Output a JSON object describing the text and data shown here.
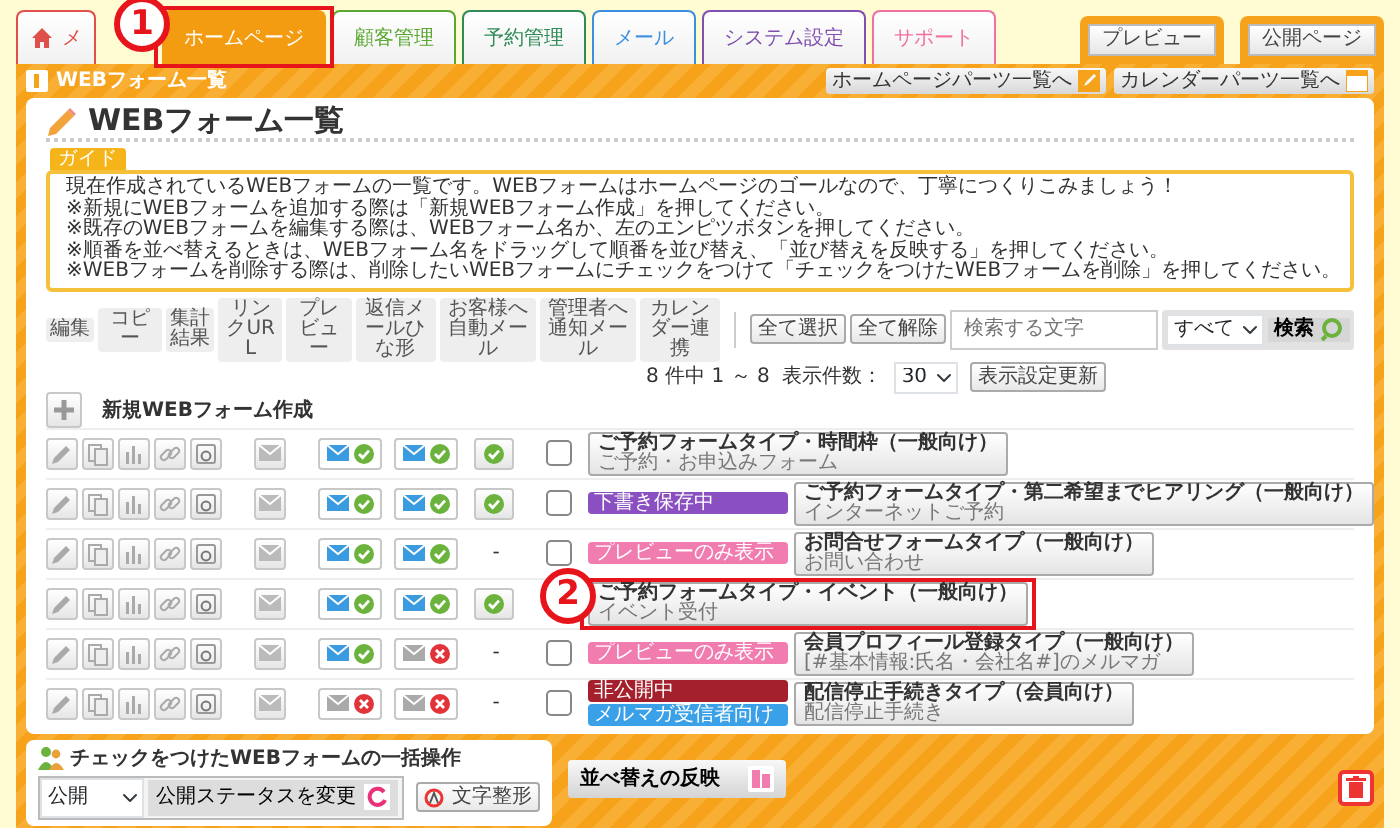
{
  "tabs": [
    {
      "kind": "home",
      "label": "メ",
      "color": "#e0504a",
      "selected": false
    },
    {
      "kind": "section",
      "label": "ホームページ",
      "color": "#f39c12",
      "selected": true,
      "callout": "1"
    },
    {
      "kind": "section",
      "label": "顧客管理",
      "color": "#5aa832",
      "selected": false
    },
    {
      "kind": "section",
      "label": "予約管理",
      "color": "#2e8b57",
      "selected": false
    },
    {
      "kind": "section",
      "label": "メール",
      "color": "#3d8fe0",
      "selected": false
    },
    {
      "kind": "section",
      "label": "システム設定",
      "color": "#8050b0",
      "selected": false
    },
    {
      "kind": "section",
      "label": "サポート",
      "color": "#f070a0",
      "selected": false
    }
  ],
  "top_buttons": [
    "プレビュー",
    "公開ページ"
  ],
  "panel": {
    "title": "WEBフォーム一覧",
    "links": [
      "ホームページパーツ一覧へ",
      "カレンダーパーツ一覧へ"
    ]
  },
  "page_title": "WEBフォーム一覧",
  "guide": {
    "tag": "ガイド",
    "lines": [
      "現在作成されているWEBフォームの一覧です。WEBフォームはホームページのゴールなので、丁寧につくりこみましょう！",
      "※新規にWEBフォームを追加する際は「新規WEBフォーム作成」を押してください。",
      "※既存のWEBフォームを編集する際は、WEBフォーム名か、左のエンピツボタンを押してください。",
      "※順番を並べ替えるときは、WEBフォーム名をドラッグして順番を並び替え、「並び替えを反映する」を押してください。",
      "※WEBフォームを削除する際は、削除したいWEBフォームにチェックをつけて「チェックをつけたWEBフォームを削除」を押してください。"
    ]
  },
  "toolbar": {
    "column_labels": [
      "編集",
      "コピー",
      "集計結果",
      "リンクURL",
      "プレビュー",
      "返信メールひな形",
      "お客様へ自動メール",
      "管理者へ通知メール",
      "カレンダー連携"
    ],
    "select_all": "全て選択",
    "clear_all": "全て解除",
    "search": {
      "placeholder": "検索する文字",
      "scope": "すべて",
      "button": "検索"
    }
  },
  "pagination": {
    "count": "8 件中 1 ～ 8",
    "per_page_label": "表示件数：",
    "per_page": "30",
    "apply": "表示設定更新"
  },
  "new_form": "新規WEBフォーム作成",
  "rows": [
    {
      "auto_mail": true,
      "admin_mail": true,
      "calendar_linked": true,
      "checked": false,
      "badges": [],
      "title": "ご予約フォームタイプ・時間枠（一般向け）",
      "subtitle": "ご予約・お申込みフォーム"
    },
    {
      "auto_mail": true,
      "admin_mail": true,
      "calendar_linked": true,
      "checked": false,
      "badges": [
        {
          "text": "下書き保存中",
          "color": "#8a4fc0"
        }
      ],
      "title": "ご予約フォームタイプ・第二希望までヒアリング（一般向け）",
      "subtitle": "インターネットご予約"
    },
    {
      "auto_mail": true,
      "admin_mail": true,
      "calendar_linked": false,
      "calendar_text": "-",
      "checked": false,
      "badges": [
        {
          "text": "プレビューのみ表示",
          "color": "#f07cb0"
        }
      ],
      "title": "お問合せフォームタイプ（一般向け）",
      "subtitle": "お問い合わせ"
    },
    {
      "auto_mail": true,
      "admin_mail": true,
      "calendar_linked": true,
      "badges": [],
      "title": "ご予約フォームタイプ・イベント（一般向け）",
      "subtitle": "イベント受付",
      "callout": "2"
    },
    {
      "auto_mail": true,
      "admin_mail": false,
      "calendar_linked": false,
      "calendar_text": "-",
      "checked": false,
      "badges": [
        {
          "text": "プレビューのみ表示",
          "color": "#f07cb0"
        }
      ],
      "title": "会員プロフィール登録タイプ（一般向け）",
      "subtitle": "[#基本情報:氏名・会社名#]のメルマガ"
    },
    {
      "auto_mail": false,
      "admin_mail": false,
      "calendar_linked": false,
      "calendar_text": "-",
      "checked": false,
      "badges": [
        {
          "text": "非公開中",
          "color": "#a3202c"
        },
        {
          "text": "メルマガ受信者向け",
          "color": "#3aa0e8"
        }
      ],
      "title": "配信停止手続きタイプ（会員向け）",
      "subtitle": "配信停止手続き"
    }
  ],
  "bulk": {
    "title": "チェックをつけたWEBフォームの一括操作",
    "status": "公開",
    "change": "公開ステータスを変更",
    "format": "文字整形"
  },
  "reorder": "並べ替えの反映"
}
